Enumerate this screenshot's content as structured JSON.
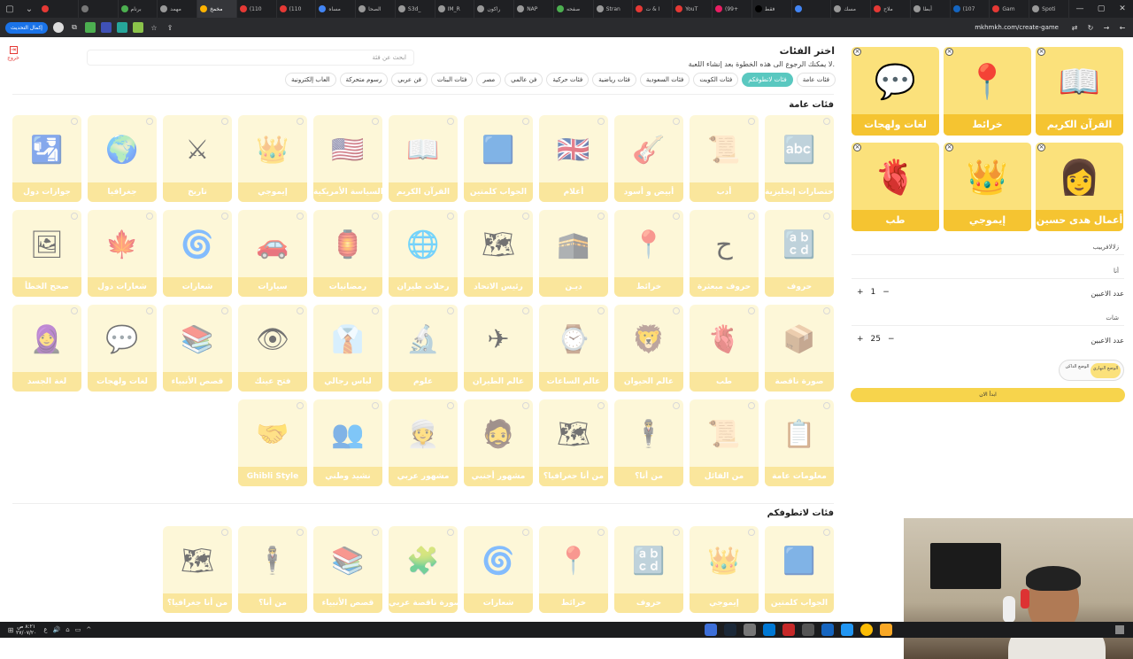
{
  "browser": {
    "tabs": [
      {
        "label": "",
        "color": "#e53935"
      },
      {
        "label": "",
        "color": "#777"
      },
      {
        "label": "برنام",
        "color": "#4caf50"
      },
      {
        "label": "مهمد",
        "color": "#999"
      },
      {
        "label": "مخمخ",
        "color": "#ffb300",
        "active": true
      },
      {
        "label": "(110",
        "color": "#e53935"
      },
      {
        "label": "(110",
        "color": "#e53935"
      },
      {
        "label": "مساه",
        "color": "#4285f4"
      },
      {
        "label": "الصحا",
        "color": "#999"
      },
      {
        "label": "S3d_",
        "color": "#999"
      },
      {
        "label": "IM_R",
        "color": "#999"
      },
      {
        "label": "راكون",
        "color": "#999"
      },
      {
        "label": "NAP",
        "color": "#999"
      },
      {
        "label": "صفحه",
        "color": "#4caf50"
      },
      {
        "label": "Stran",
        "color": "#999"
      },
      {
        "label": "ا & ت",
        "color": "#e53935"
      },
      {
        "label": "YouT",
        "color": "#e53935"
      },
      {
        "label": "(99+",
        "color": "#e91e63"
      },
      {
        "label": "فقط",
        "color": "#000"
      },
      {
        "label": "",
        "color": "#4285f4"
      },
      {
        "label": "مسك",
        "color": "#999"
      },
      {
        "label": "ملاح",
        "color": "#e53935"
      },
      {
        "label": "أبطا",
        "color": "#999"
      },
      {
        "label": "(107",
        "color": "#1565c0"
      },
      {
        "label": "Gam",
        "color": "#e53935"
      },
      {
        "label": "Spoti",
        "color": "#999"
      }
    ],
    "update_label": "إكمال التحديث",
    "url": "mkhmkh.com/create-game"
  },
  "page": {
    "exit_label": "خروج",
    "title": "اختر الفئات",
    "subtitle": "لا يمكنك الرجوع الى هذه الخطوة بعد إنشاء اللعبة.",
    "search_placeholder": "ابحث عن فئة",
    "chips": [
      "فئات عامة",
      "فئات لاتطوفكم",
      "فئات الكويت",
      "فئات السعودية",
      "فئات رياضية",
      "فئات حركية",
      "فن عالمي",
      "مصر",
      "فئات البنات",
      "فن عربي",
      "رسوم متحركة",
      "العاب إلكترونية"
    ],
    "section_general": "فئات عامة",
    "section_latatofkom": "فئات لاتطوفكم",
    "general_cards": [
      {
        "label": "اختصارات إنجليزية",
        "icon": "🔤"
      },
      {
        "label": "أدب",
        "icon": "📜"
      },
      {
        "label": "أبيض و أسود",
        "icon": "🎸"
      },
      {
        "label": "أعلام",
        "icon": "🇬🇧"
      },
      {
        "label": "الجواب كلمتين",
        "icon": "🟦"
      },
      {
        "label": "القرآن الكريم",
        "icon": "📖"
      },
      {
        "label": "السياسة الأمريكية",
        "icon": "🇺🇸"
      },
      {
        "label": "إيموجي",
        "icon": "👑"
      },
      {
        "label": "تاريخ",
        "icon": "⚔"
      },
      {
        "label": "جغرافيا",
        "icon": "🌍"
      },
      {
        "label": "جوازات دول",
        "icon": "🛂"
      },
      {
        "label": "حروف",
        "icon": "🔡"
      },
      {
        "label": "حروف مبعثرة",
        "icon": "ح"
      },
      {
        "label": "خرائط",
        "icon": "📍"
      },
      {
        "label": "ديـن",
        "icon": "🕋"
      },
      {
        "label": "رئيس الاتحاد",
        "icon": "🗺"
      },
      {
        "label": "رحلات طيران",
        "icon": "🌐"
      },
      {
        "label": "رمضانيات",
        "icon": "🏮"
      },
      {
        "label": "سيارات",
        "icon": "🚗"
      },
      {
        "label": "شعارات",
        "icon": "🌀"
      },
      {
        "label": "شعارات دول",
        "icon": "🍁"
      },
      {
        "label": "صحح الخطأ",
        "icon": "🖼"
      },
      {
        "label": "صورة ناقصة",
        "icon": "📦"
      },
      {
        "label": "طب",
        "icon": "🫀"
      },
      {
        "label": "عالم الحيوان",
        "icon": "🦁"
      },
      {
        "label": "عالم الساعات",
        "icon": "⌚"
      },
      {
        "label": "عالم الطيران",
        "icon": "✈"
      },
      {
        "label": "علوم",
        "icon": "🔬"
      },
      {
        "label": "لباس رجالي",
        "icon": "👔"
      },
      {
        "label": "فتح عينك",
        "icon": "👁"
      },
      {
        "label": "قصص الأنبياء",
        "icon": "📚"
      },
      {
        "label": "لغات ولهجات",
        "icon": "💬"
      },
      {
        "label": "لغة الجسد",
        "icon": "🧕"
      },
      {
        "label": "معلومات عامة",
        "icon": "📋"
      },
      {
        "label": "من القائل",
        "icon": "📜"
      },
      {
        "label": "من أنا؟",
        "icon": "🕴"
      },
      {
        "label": "من أنا جغرافيا؟",
        "icon": "🗺"
      },
      {
        "label": "مشهور أجنبي",
        "icon": "🧔"
      },
      {
        "label": "مشهور عربي",
        "icon": "👳"
      },
      {
        "label": "نشيد وطني",
        "icon": "👥"
      },
      {
        "label": "Ghibli Style",
        "icon": "🤝"
      }
    ],
    "latatofkom_cards": [
      {
        "label": "الجواب كلمتين",
        "icon": "🟦"
      },
      {
        "label": "إيموجي",
        "icon": "👑"
      },
      {
        "label": "حروف",
        "icon": "🔡"
      },
      {
        "label": "خرائط",
        "icon": "📍"
      },
      {
        "label": "شعارات",
        "icon": "🌀"
      },
      {
        "label": "صورة ناقصة عربي",
        "icon": "🧩"
      },
      {
        "label": "قصص الأنبياء",
        "icon": "📚"
      },
      {
        "label": "من أنا؟",
        "icon": "🕴"
      },
      {
        "label": "من أنا جغرافيا؟",
        "icon": "🗺"
      }
    ],
    "selected": [
      {
        "label": "القرآن الكريم",
        "icon": "📖"
      },
      {
        "label": "خرائط",
        "icon": "📍"
      },
      {
        "label": "لغات ولهجات",
        "icon": "💬"
      },
      {
        "label": "أعمال هدى حسين",
        "icon": "👩"
      },
      {
        "label": "إيموجي",
        "icon": "👑"
      },
      {
        "label": "طب",
        "icon": "🫀"
      }
    ],
    "game_name": "زلالافرييب",
    "team1_name": "أنا",
    "team1_players_label": "عدد الاعبين",
    "team1_players": "1",
    "team2_name": "شات",
    "team2_players_label": "عدد الاعبين",
    "team2_players": "25",
    "mode_off": "الوضع الداكن",
    "mode_on": "الوضع النهاري",
    "start_label": "ابدأ الان"
  },
  "taskbar": {
    "time": "٨:٢١ ص",
    "date": "٢٧/٠٧/٢٠"
  }
}
